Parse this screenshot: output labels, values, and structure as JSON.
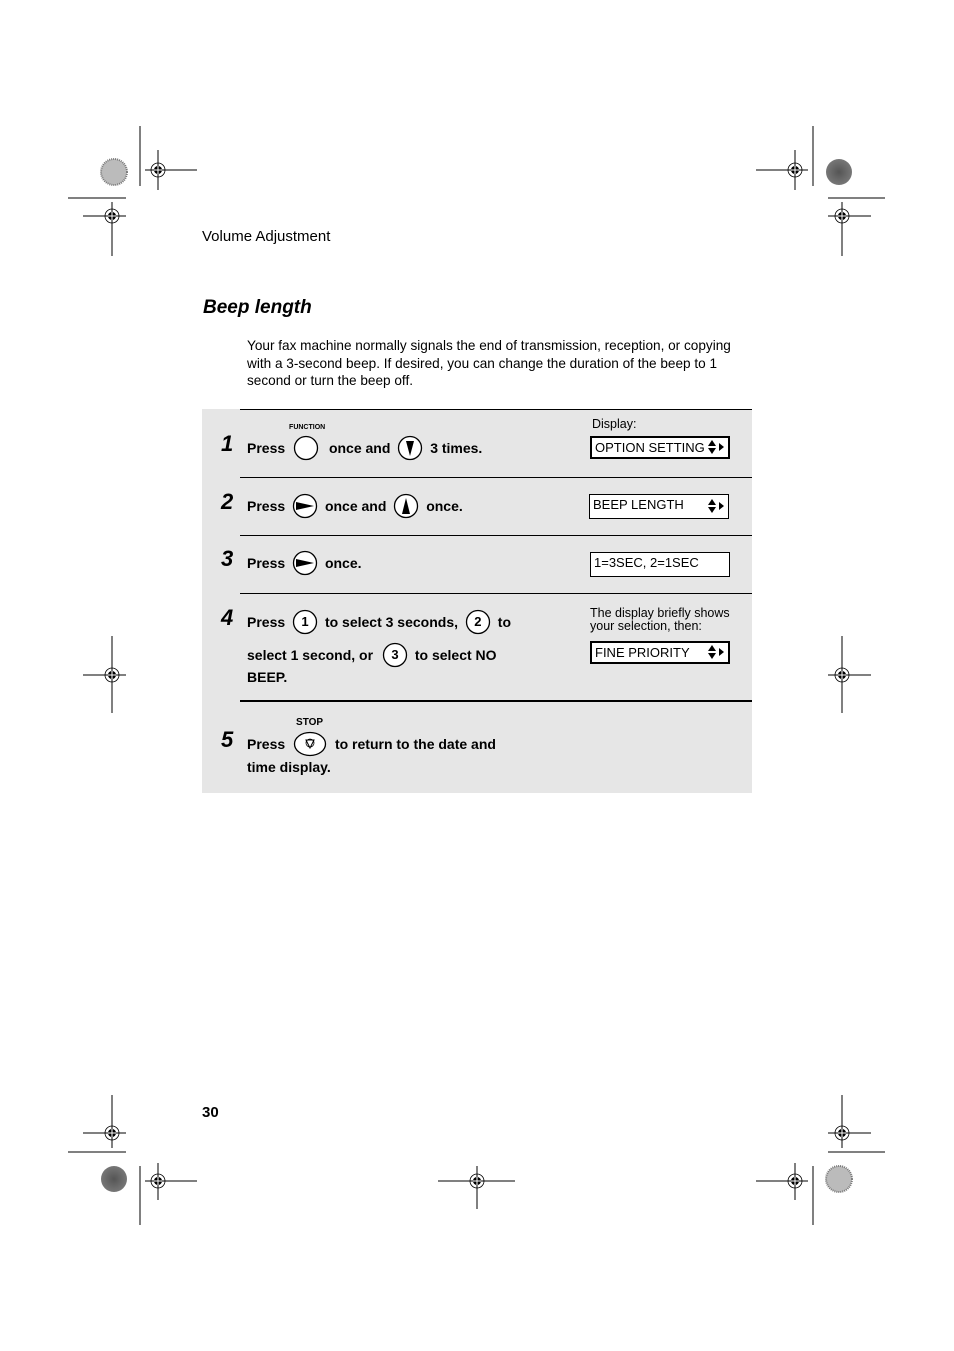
{
  "header": {
    "running_head": "Volume Adjustment"
  },
  "section": {
    "title": "Beep length",
    "intro": "Your fax machine normally signals the end of transmission, reception, or copying with a 3-second beep. If desired, you can change the duration of the beep to 1 second or turn the beep off."
  },
  "steps": [
    {
      "number": "1",
      "parts": [
        "Press",
        "once and",
        "3 times."
      ],
      "keys": [
        {
          "label": "FUNCTION",
          "icon": "function-key-icon"
        },
        {
          "icon": "down-arrow-key-icon"
        }
      ],
      "display_label": "Display:",
      "display": "OPTION SETTING"
    },
    {
      "number": "2",
      "parts": [
        "Press",
        "once and",
        "once."
      ],
      "keys": [
        {
          "icon": "right-arrow-key-icon"
        },
        {
          "icon": "up-arrow-key-icon"
        }
      ],
      "display": "BEEP LENGTH"
    },
    {
      "number": "3",
      "parts": [
        "Press",
        "once."
      ],
      "keys": [
        {
          "icon": "right-arrow-key-icon"
        }
      ],
      "display": "1=3SEC, 2=1SEC"
    },
    {
      "number": "4",
      "line1": [
        "Press",
        "to select 3 seconds,",
        "to"
      ],
      "line2": [
        "select 1 second, or",
        "to select NO"
      ],
      "line3": "BEEP.",
      "keys": [
        "1",
        "2",
        "3"
      ],
      "note": "The display briefly shows your selection, then:",
      "display": "FINE PRIORITY"
    },
    {
      "number": "5",
      "parts": [
        "Press",
        "to return to the date and"
      ],
      "line2": "time display.",
      "keys": [
        {
          "label": "STOP",
          "icon": "stop-key-icon"
        }
      ]
    }
  ],
  "footer": {
    "page_number": "30"
  }
}
